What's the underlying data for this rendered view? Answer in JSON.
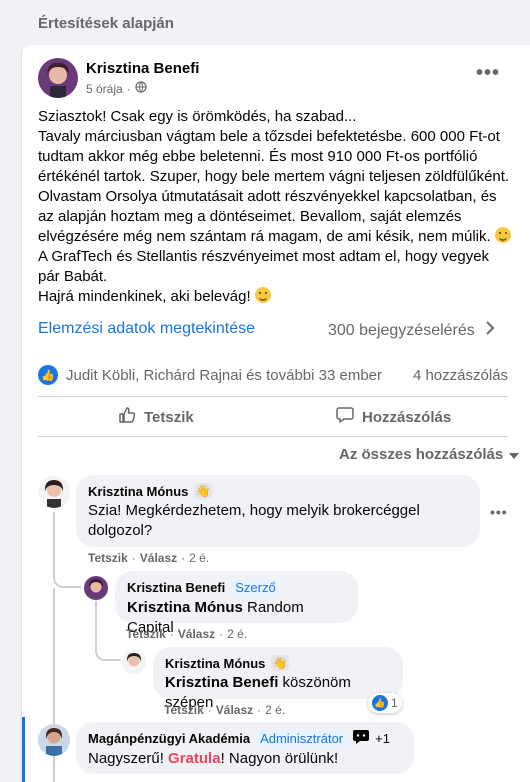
{
  "section_title": "Értesítések alapján",
  "post": {
    "author": "Krisztina Benefi",
    "time": "5 órája",
    "audience_icon": "globe-icon",
    "menu_icon": "more-horizontal-icon",
    "lines": [
      "Sziasztok! Csak egy is örömködés, ha szabad...",
      "Tavaly márciusban vágtam bele a tőzsdei befektetésbe. 600 000 Ft-ot tudtam akkor még ebbe beletenni. És most 910 000 Ft-os portfólió értékénél tartok. Szuper, hogy bele mertem vágni teljesen zöldfülűként. Olvastam Orsolya útmutatásait adott részvényekkel kapcsolatban, és az alapján hoztam meg a döntéseimet. Bevallom, saját elemzés elvégzésére még nem szántam rá magam, de ami késik, nem múlik.",
      "A GrafTech és Stellantis részvényeimet most adtam el, hogy vegyek pár Babát.",
      "Hajrá mindenkinek, aki belevág!"
    ],
    "insights_link": "Elemzési adatok megtekintése",
    "reach": "300 bejegyzéselérés",
    "reactions_text": "Judit Köbli, Richárd Rajnai és további 33 ember",
    "comment_count": "4 hozzászólás",
    "like_label": "Tetszik",
    "comment_label": "Hozzászólás",
    "sort_label": "Az összes hozzászólás"
  },
  "comments": [
    {
      "author": "Krisztina Mónus",
      "badge_icon": "wave-hand-icon",
      "text": "Szia! Megkérdezhetem, hogy melyik brokercéggel dolgozol?",
      "like": "Tetszik",
      "reply": "Válasz",
      "time": "2 é."
    },
    {
      "author": "Krisztina Benefi",
      "role": "Szerző",
      "mention": "Krisztina Mónus",
      "text": "Random Capital",
      "like": "Tetszik",
      "reply": "Válasz",
      "time": "2 é."
    },
    {
      "author": "Krisztina Mónus",
      "badge_icon": "wave-hand-icon",
      "mention": "Krisztina Benefi",
      "text": "köszönöm szépen",
      "like": "Tetszik",
      "reply": "Válasz",
      "time": "2 é.",
      "reaction_count": "1"
    },
    {
      "author": "Magánpénzügyi Akadémia",
      "role": "Adminisztrátor",
      "extra": "+1",
      "text_a": "Nagyszerű!",
      "text_b": "Gratula",
      "text_c": "! Nagyon örülünk!"
    }
  ],
  "colors": {
    "accent": "#1b74e4",
    "gratula": "#f3425f"
  }
}
